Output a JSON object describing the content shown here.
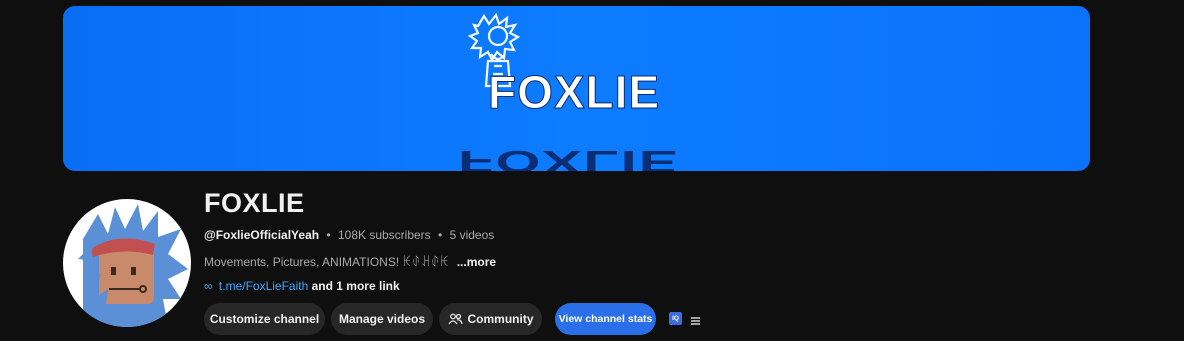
{
  "banner": {
    "logo_text": "FOXLIE",
    "background_color": "#0d7cff"
  },
  "channel": {
    "name": "FOXLIE",
    "handle": "@FoxlieOfficialYeah",
    "subscribers": "108K subscribers",
    "separator": "•",
    "videos": "5 videos",
    "description": "Movements, Pictures, ANIMATIONS! ꀘꂑꃅꂑꀘ",
    "more_label": "...more",
    "link_icon": "link-icon",
    "link_text": "t.me/FoxLieFaith",
    "more_links": "and 1 more link"
  },
  "actions": {
    "customize": "Customize channel",
    "manage": "Manage videos",
    "community_icon": "people-icon",
    "community": "Community",
    "stats": "View channel stats",
    "iq_badge": "IQ",
    "menu_icon": "hamburger-icon"
  },
  "colors": {
    "page_bg": "#0f0f0f",
    "button_bg": "#272727",
    "primary_button": "#2b6fe8",
    "link": "#3ea6ff"
  }
}
